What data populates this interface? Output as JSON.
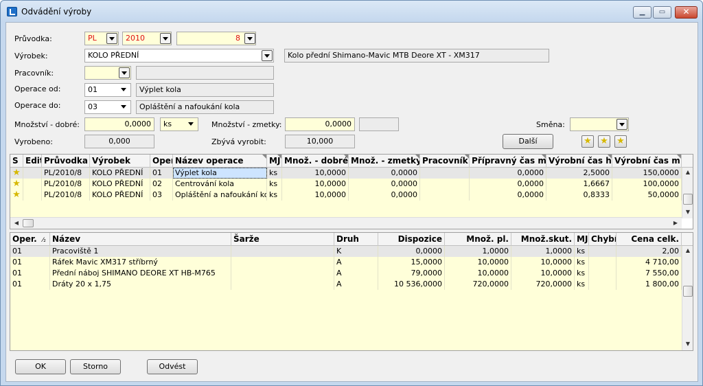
{
  "window": {
    "title": "Odvádění výroby"
  },
  "form": {
    "pruvodka_label": "Průvodka:",
    "pruvodka_prefix": "PL",
    "pruvodka_year": "2010",
    "pruvodka_number": "8",
    "vyrobek_label": "Výrobek:",
    "vyrobek_value": "KOLO PŘEDNÍ",
    "vyrobek_desc": "Kolo přední Shimano-Mavic MTB Deore XT - XM317",
    "pracovnik_label": "Pracovník:",
    "pracovnik_value": "",
    "pracovnik_name": "",
    "operace_od_label": "Operace od:",
    "operace_od_value": "01",
    "operace_od_name": "Výplet kola",
    "operace_do_label": "Operace do:",
    "operace_do_value": "03",
    "operace_do_name": "Opláštění a nafoukání kola",
    "mnozstvi_dobre_label": "Množství - dobré:",
    "mnozstvi_dobre_value": "0,0000",
    "mj_value": "ks",
    "mnozstvi_zmetky_label": "Množství - zmetky:",
    "mnozstvi_zmetky_value": "0,0000",
    "mnozstvi_zmetky_extra": "",
    "smena_label": "Směna:",
    "smena_value": "",
    "vyrobeno_label": "Vyrobeno:",
    "vyrobeno_value": "0,000",
    "zbyva_label": "Zbývá vyrobit:",
    "zbyva_value": "10,000",
    "dalsi_label": "Další"
  },
  "ops_grid": {
    "columns": [
      "S",
      "Edit",
      "Průvodka",
      "Výrobek",
      "Oper",
      "Název operace",
      "MJ",
      "Množ. - dobré",
      "Množ. - zmetky",
      "Pracovník",
      "Přípravný čas m",
      "Výrobní čas h",
      "Výrobní čas m"
    ],
    "rows": [
      {
        "s": "star",
        "edit": "",
        "pruvodka": "PL/2010/8",
        "vyrobek": "KOLO PŘEDNÍ",
        "oper": "01",
        "nazev": "Výplet kola",
        "mj": "ks",
        "dobre": "10,0000",
        "zmetky": "0,0000",
        "pracovnik": "",
        "pripravny": "0,0000",
        "vyr_h": "2,5000",
        "vyr_m": "150,0000"
      },
      {
        "s": "star",
        "edit": "",
        "pruvodka": "PL/2010/8",
        "vyrobek": "KOLO PŘEDNÍ",
        "oper": "02",
        "nazev": "Centrování kola",
        "mj": "ks",
        "dobre": "10,0000",
        "zmetky": "0,0000",
        "pracovnik": "",
        "pripravny": "0,0000",
        "vyr_h": "1,6667",
        "vyr_m": "100,0000"
      },
      {
        "s": "star",
        "edit": "",
        "pruvodka": "PL/2010/8",
        "vyrobek": "KOLO PŘEDNÍ",
        "oper": "03",
        "nazev": "Opláštění a nafoukání kola",
        "mj": "ks",
        "dobre": "10,0000",
        "zmetky": "0,0000",
        "pracovnik": "",
        "pripravny": "0,0000",
        "vyr_h": "0,8333",
        "vyr_m": "50,0000"
      }
    ]
  },
  "mat_grid": {
    "columns": [
      "Oper.",
      "Název",
      "Šarže",
      "Druh",
      "Dispozice",
      "Množ. pl.",
      "Množ.skut.",
      "MJ",
      "Chybí",
      "Cena celk."
    ],
    "sort_indicator": "⁄₂",
    "rows": [
      {
        "oper": "01",
        "nazev": "Pracoviště 1",
        "sarze": "",
        "druh": "K",
        "dispozice": "0,0000",
        "pl": "1,0000",
        "skut": "1,0000",
        "mj": "ks",
        "chybi": "",
        "cena": "2,00"
      },
      {
        "oper": "01",
        "nazev": "Ráfek Mavic XM317 stříbrný",
        "sarze": "",
        "druh": "A",
        "dispozice": "15,0000",
        "pl": "10,0000",
        "skut": "10,0000",
        "mj": "ks",
        "chybi": "",
        "cena": "4 710,00"
      },
      {
        "oper": "01",
        "nazev": "Přední náboj SHIMANO DEORE XT HB-M765",
        "sarze": "",
        "druh": "A",
        "dispozice": "79,0000",
        "pl": "10,0000",
        "skut": "10,0000",
        "mj": "ks",
        "chybi": "",
        "cena": "7 550,00"
      },
      {
        "oper": "01",
        "nazev": "Dráty 20 x 1,75",
        "sarze": "",
        "druh": "A",
        "dispozice": "10 536,0000",
        "pl": "720,0000",
        "skut": "720,0000",
        "mj": "ks",
        "chybi": "",
        "cena": "1 800,00"
      }
    ]
  },
  "buttons": {
    "ok": "OK",
    "storno": "Storno",
    "odvest": "Odvést"
  },
  "colors": {
    "row_yellow": "#ffffd9",
    "selected": "#cde4ff",
    "red_text": "#e01010"
  }
}
